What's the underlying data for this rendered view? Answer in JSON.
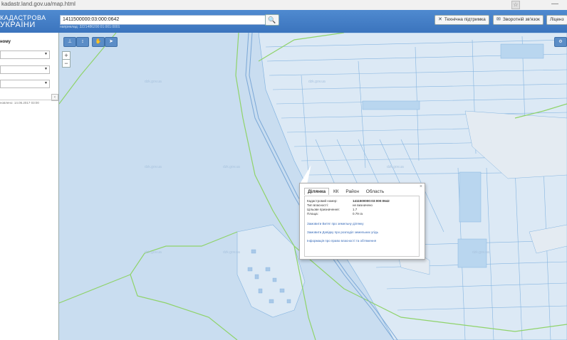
{
  "browser": {
    "url": "kadastr.land.gov.ua/map.html"
  },
  "header": {
    "logo_line1": "КАДАСТРОВА",
    "logo_line2": "УКРАЇНИ",
    "search_value": "1411500000:03:000:0642",
    "search_hint": "наприклад: 3221486200:01:001:0001",
    "buttons": [
      "Технічна підтримка",
      "Зворотній зв'язок",
      "Ліценз"
    ]
  },
  "sidebar": {
    "title": "ному",
    "selects": [
      "",
      "",
      ""
    ],
    "updated": "новлено: 14.06.2017 03:00"
  },
  "map": {
    "zoom_in": "+",
    "zoom_out": "−",
    "watermark": "dzk.gov.ua"
  },
  "popup": {
    "tabs": [
      "Ділянка",
      "КК",
      "Район",
      "Область"
    ],
    "active_tab": "Ділянка",
    "rows": [
      {
        "label": "Кадастровий номер:",
        "value": "1411500000:03:000:0642"
      },
      {
        "label": "Тип власності:",
        "value": "не визначено"
      },
      {
        "label": "Цільове призначення:",
        "value": "1.7"
      },
      {
        "label": "Площа:",
        "value": "0.79 га"
      }
    ],
    "links": [
      "Замовити Витяг про земельну ділянку",
      "Замовити Довідку про розподіл земельних угідь",
      "Інформація про право власності та обтяження"
    ]
  },
  "colors": {
    "header": "#3b74bd",
    "map_bg": "#c9ddf0",
    "parcel_fill": "#dce9f5",
    "parcel_stroke": "#86b5e0",
    "boundary": "#8fd36a",
    "blank_area": "#e4ebf2"
  }
}
